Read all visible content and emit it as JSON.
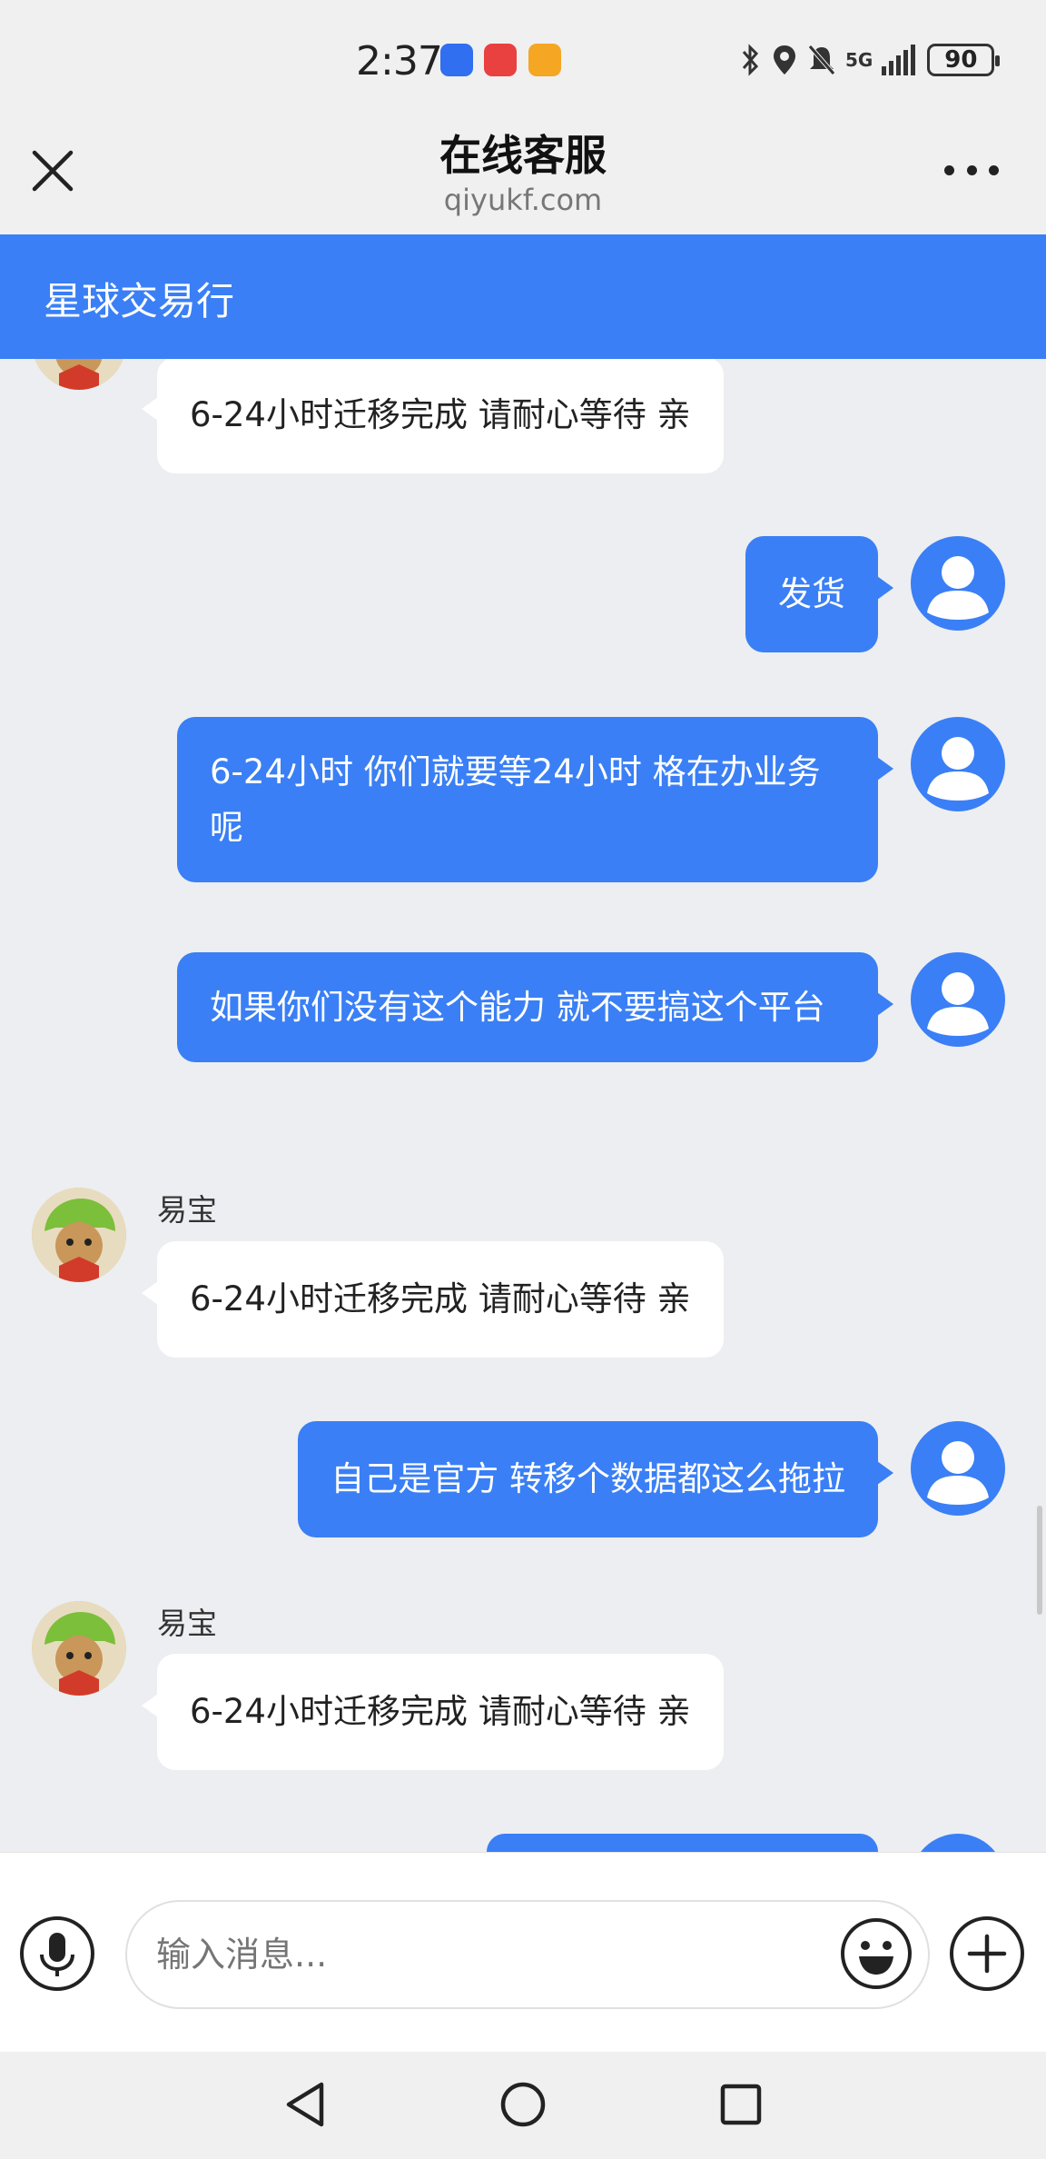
{
  "status_bar": {
    "time": "2:37",
    "apps": [
      {
        "icon": "app-icon-blue",
        "color": "#2f6ff0"
      },
      {
        "icon": "huawei-store-icon",
        "color": "#e94040"
      },
      {
        "icon": "app-icon-orange",
        "color": "#f5a623"
      }
    ],
    "network": "5G",
    "battery": "90"
  },
  "header": {
    "title": "在线客服",
    "subtitle": "qiyukf.com"
  },
  "store": {
    "name": "星球交易行"
  },
  "messages": [
    {
      "side": "in",
      "text": "6-24小时迁移完成 请耐心等待 亲"
    },
    {
      "side": "out",
      "text": "发货"
    },
    {
      "side": "out",
      "text": "6-24小时 你们就要等24小时  格在办业务呢"
    },
    {
      "side": "out",
      "text": "如果你们没有这个能力 就不要搞这个平台"
    },
    {
      "side": "in",
      "sender": "易宝",
      "text": "6-24小时迁移完成 请耐心等待 亲"
    },
    {
      "side": "out",
      "text": "自己是官方 转移个数据都这么拖拉"
    },
    {
      "side": "in",
      "sender": "易宝",
      "text": "6-24小时迁移完成 请耐心等待 亲"
    }
  ],
  "input": {
    "placeholder": "输入消息..."
  },
  "colors": {
    "accent": "#3a7ff5",
    "chat_bg": "#eceef1"
  }
}
